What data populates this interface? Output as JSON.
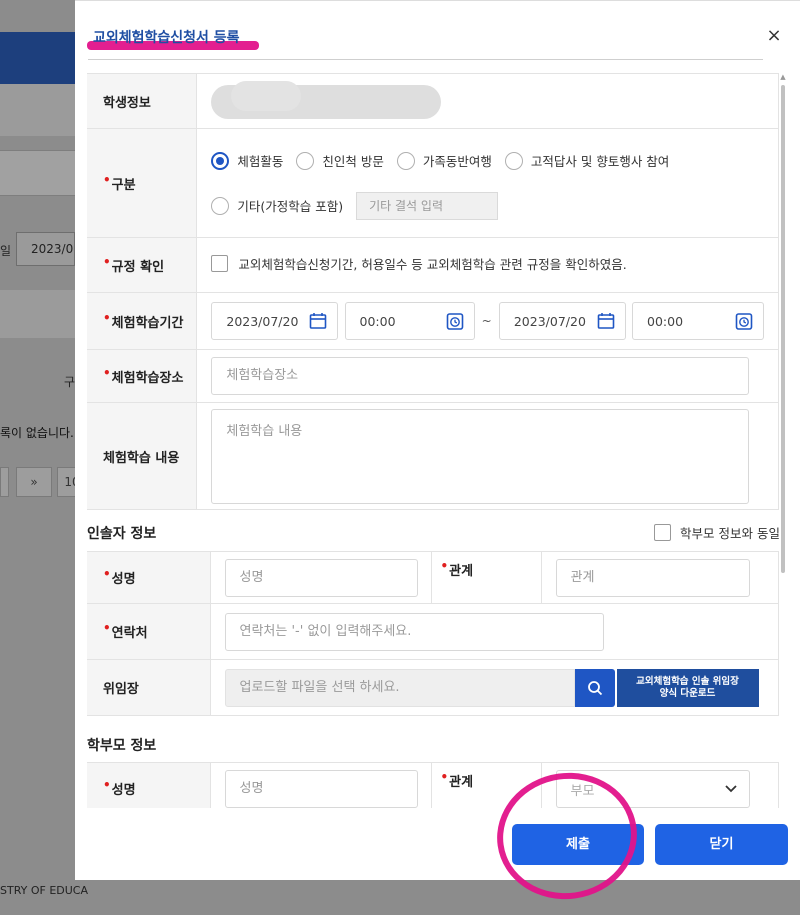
{
  "background": {
    "date_label": "일",
    "date_value": "2023/07",
    "column_fragment": "구",
    "empty_text": "록이 없습니다.",
    "pager_next": "»",
    "pager_size": "10",
    "footer_text": "STRY OF EDUCA"
  },
  "modal": {
    "title": "교외체험학습신청서 등록",
    "close": "×"
  },
  "form": {
    "student_label": "학생정보",
    "type_label": "구분",
    "type_options": [
      "체험활동",
      "친인척 방문",
      "가족동반여행",
      "고적답사 및 향토행사 참여",
      "기타(가정학습 포함)"
    ],
    "type_selected": "체험활동",
    "other_placeholder": "기타 결석 입력",
    "rule_label": "규정 확인",
    "rule_text": "교외체험학습신청기간, 허용일수 등 교외체험학습 관련 규정을 확인하였음.",
    "period_label": "체험학습기간",
    "start_date": "2023/07/20",
    "start_time": "00:00",
    "range_sep": "~",
    "end_date": "2023/07/20",
    "end_time": "00:00",
    "place_label": "체험학습장소",
    "place_placeholder": "체험학습장소",
    "content_label": "체험학습 내용",
    "content_placeholder": "체험학습 내용"
  },
  "guardian": {
    "section_title": "인솔자 정보",
    "same_as_parent": "학부모 정보와 동일",
    "name_label": "성명",
    "name_placeholder": "성명",
    "relation_label": "관계",
    "relation_placeholder": "관계",
    "contact_label": "연락처",
    "contact_placeholder": "연락처는 '-' 없이 입력해주세요.",
    "delegation_label": "위임장",
    "file_placeholder": "업로드할 파일을 선택 하세요.",
    "download_line1": "교외체험학습 인솔 위임장",
    "download_line2": "양식 다운로드"
  },
  "parent": {
    "section_title": "학부모 정보",
    "name_label": "성명",
    "name_placeholder": "성명",
    "relation_label": "관계",
    "relation_value": "부모"
  },
  "footer": {
    "submit": "제출",
    "close": "닫기"
  },
  "colors": {
    "primary": "#1f63e4",
    "title": "#1f4ea3",
    "highlight": "#e2138a",
    "required": "#e02020"
  }
}
